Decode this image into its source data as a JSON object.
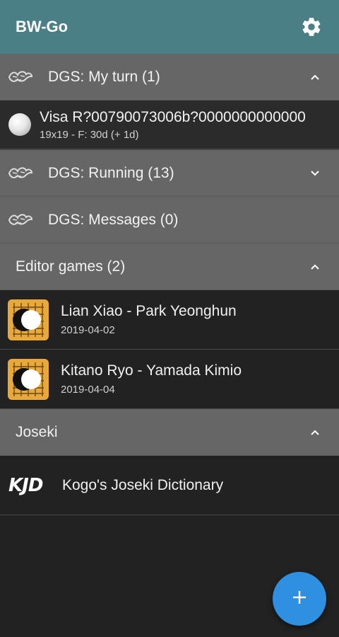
{
  "app": {
    "title": "BW-Go",
    "accent": "#4a7f86",
    "fab_color": "#2f8fe0"
  },
  "dgs_my_turn": {
    "label": "DGS: My turn (1)",
    "expanded": true,
    "items": [
      {
        "title": "Visa R?00790073006b?0000000000000",
        "subtitle": "19x19 - F: 30d (+ 1d)"
      }
    ]
  },
  "dgs_running": {
    "label": "DGS: Running (13)",
    "expanded": false
  },
  "dgs_messages": {
    "label": "DGS: Messages (0)"
  },
  "editor_games": {
    "label": "Editor games (2)",
    "expanded": true,
    "items": [
      {
        "title": "Lian Xiao - Park Yeonghun",
        "date": "2019-04-02"
      },
      {
        "title": "Kitano Ryo - Yamada Kimio",
        "date": "2019-04-04"
      }
    ]
  },
  "joseki": {
    "label": "Joseki",
    "expanded": true,
    "items": [
      {
        "logo": "KJD",
        "title": "Kogo's Joseki Dictionary"
      }
    ]
  },
  "icons": {
    "settings": "gear-icon",
    "dgs": "dragon-icon",
    "expanded": "chevron-up-icon",
    "collapsed": "chevron-down-icon",
    "fab": "plus-icon"
  }
}
